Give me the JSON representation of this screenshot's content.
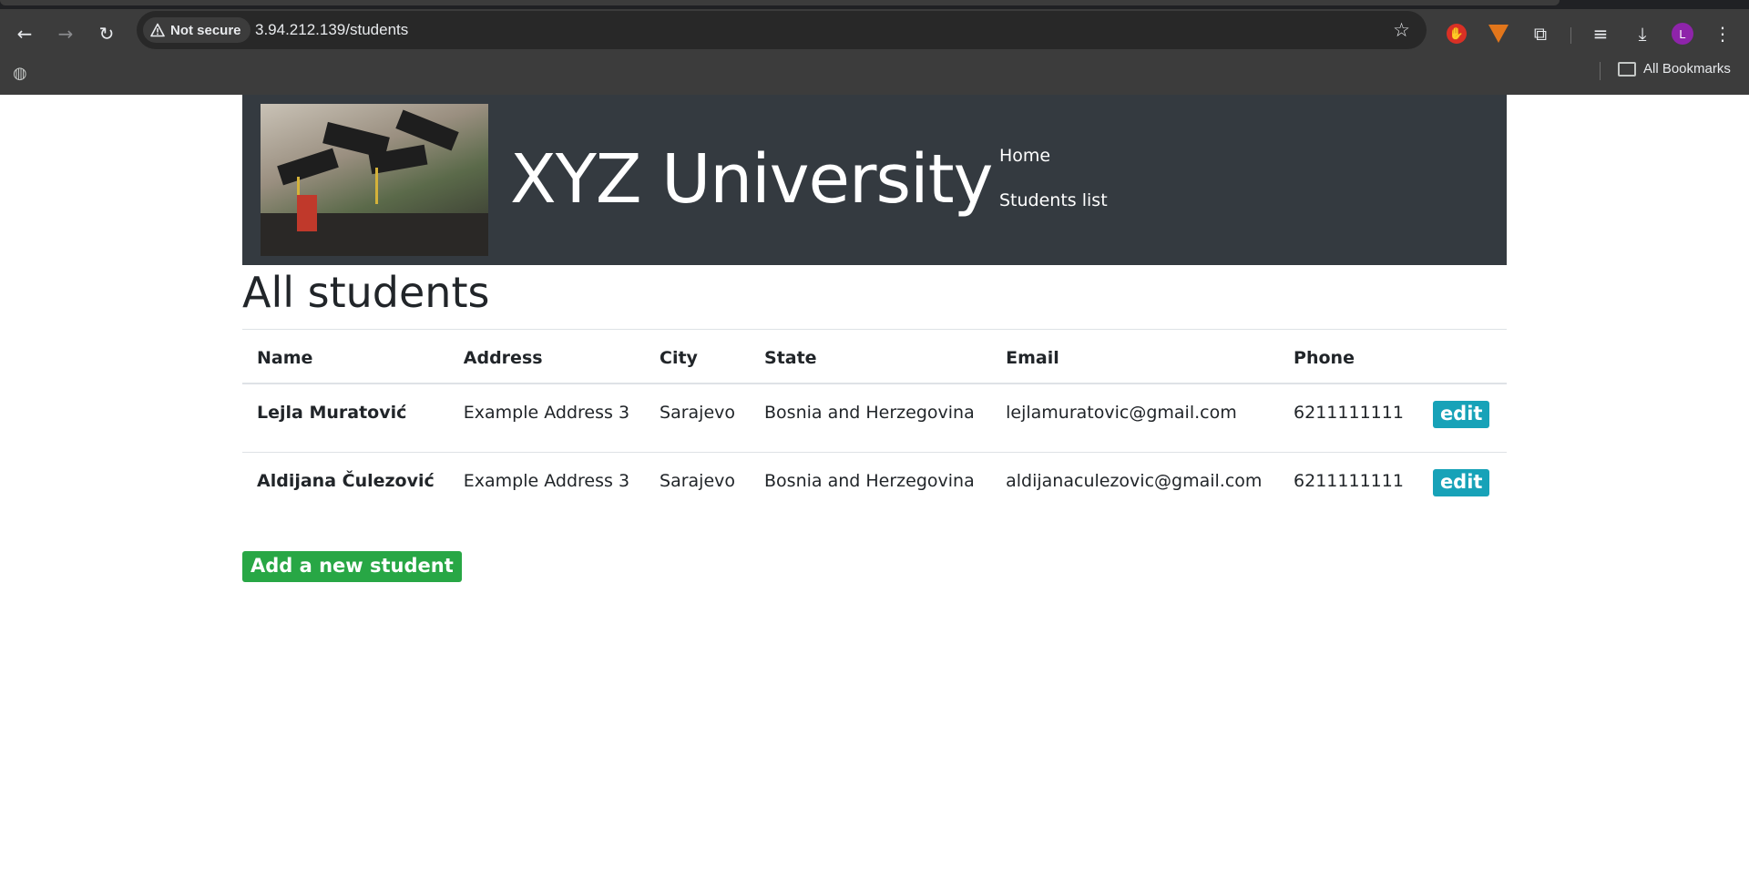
{
  "browser": {
    "security_label": "Not secure",
    "url": "3.94.212.139/students",
    "avatar_letter": "L",
    "bookmarks_label": "All Bookmarks"
  },
  "site": {
    "title": "XYZ University",
    "nav": [
      {
        "label": "Home"
      },
      {
        "label": "Students list"
      }
    ]
  },
  "page": {
    "heading": "All students",
    "add_button_label": "Add a new student"
  },
  "table": {
    "headers": [
      "Name",
      "Address",
      "City",
      "State",
      "Email",
      "Phone",
      ""
    ],
    "rows": [
      {
        "name": "Lejla Muratović",
        "address": "Example Address 3",
        "city": "Sarajevo",
        "state": "Bosnia and Herzegovina",
        "email": "lejlamuratovic@gmail.com",
        "phone": "6211111111",
        "action": "edit"
      },
      {
        "name": "Aldijana Čulezović",
        "address": "Example Address 3",
        "city": "Sarajevo",
        "state": "Bosnia and Herzegovina",
        "email": "aldijanaculezovic@gmail.com",
        "phone": "6211111111",
        "action": "edit"
      }
    ]
  },
  "colors": {
    "header_bg": "#343a40",
    "edit_button": "#17a2b8",
    "add_button": "#28a745"
  }
}
